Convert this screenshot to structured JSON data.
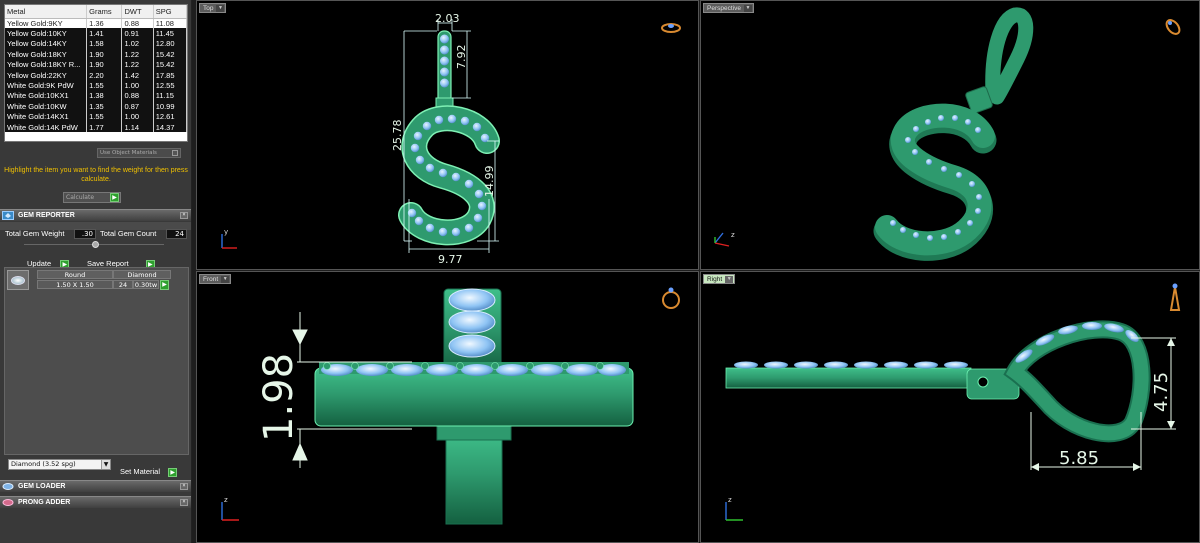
{
  "metal_table": {
    "headers": [
      "Metal",
      "Grams",
      "DWT",
      "SPG"
    ],
    "rows": [
      [
        "Yellow Gold:9KY",
        "1.36",
        "0.88",
        "11.08"
      ],
      [
        "Yellow Gold:10KY",
        "1.41",
        "0.91",
        "11.45"
      ],
      [
        "Yellow Gold:14KY",
        "1.58",
        "1.02",
        "12.80"
      ],
      [
        "Yellow Gold:18KY",
        "1.90",
        "1.22",
        "15.42"
      ],
      [
        "Yellow Gold:18KY R...",
        "1.90",
        "1.22",
        "15.42"
      ],
      [
        "Yellow Gold:22KY",
        "2.20",
        "1.42",
        "17.85"
      ],
      [
        "White Gold:9K PdW",
        "1.55",
        "1.00",
        "12.55"
      ],
      [
        "White Gold:10KX1",
        "1.38",
        "0.88",
        "11.15"
      ],
      [
        "White Gold:10KW",
        "1.35",
        "0.87",
        "10.99"
      ],
      [
        "White Gold:14KX1",
        "1.55",
        "1.00",
        "12.61"
      ],
      [
        "White Gold:14K PdW",
        "1.77",
        "1.14",
        "14.37"
      ]
    ]
  },
  "use_object_materials": "Use Object Materials",
  "hint": "Highlight the item you want to find the weight for then press calculate.",
  "calculate_label": "Calculate",
  "gem_reporter": {
    "title": "GEM REPORTER",
    "total_weight_label": "Total Gem Weight",
    "total_weight_value": ".30",
    "total_count_label": "Total Gem Count",
    "total_count_value": "24",
    "update_label": "Update",
    "save_report_label": "Save Report",
    "gem": {
      "shape": "Round",
      "type": "Diamond",
      "size": "1.50 X 1.50",
      "count": "24",
      "carat": "0.30tw"
    }
  },
  "material_select": "Diamond   (3.52 spg)",
  "set_material_label": "Set Material",
  "gem_loader_title": "GEM LOADER",
  "prong_adder_title": "PRONG ADDER",
  "viewports": {
    "top": {
      "label": "Top",
      "dims": {
        "width_top": "2.03",
        "bail_height": "7.92",
        "total_height": "25.78",
        "s_height": "14.99",
        "width": "9.77"
      },
      "axis": "y"
    },
    "perspective": {
      "label": "Perspective",
      "axis": "z"
    },
    "front": {
      "label": "Front",
      "dims": {
        "thickness": "1.98"
      },
      "axis": "z"
    },
    "right": {
      "label": "Right",
      "dims": {
        "bail_height": "4.75",
        "bail_width": "5.85"
      },
      "axis": "z"
    }
  },
  "colors": {
    "metal": "#2e9a6e",
    "gem": "#8fc4f4",
    "dim_text": "#e6f6e8",
    "hint_yellow": "#f0c000"
  }
}
